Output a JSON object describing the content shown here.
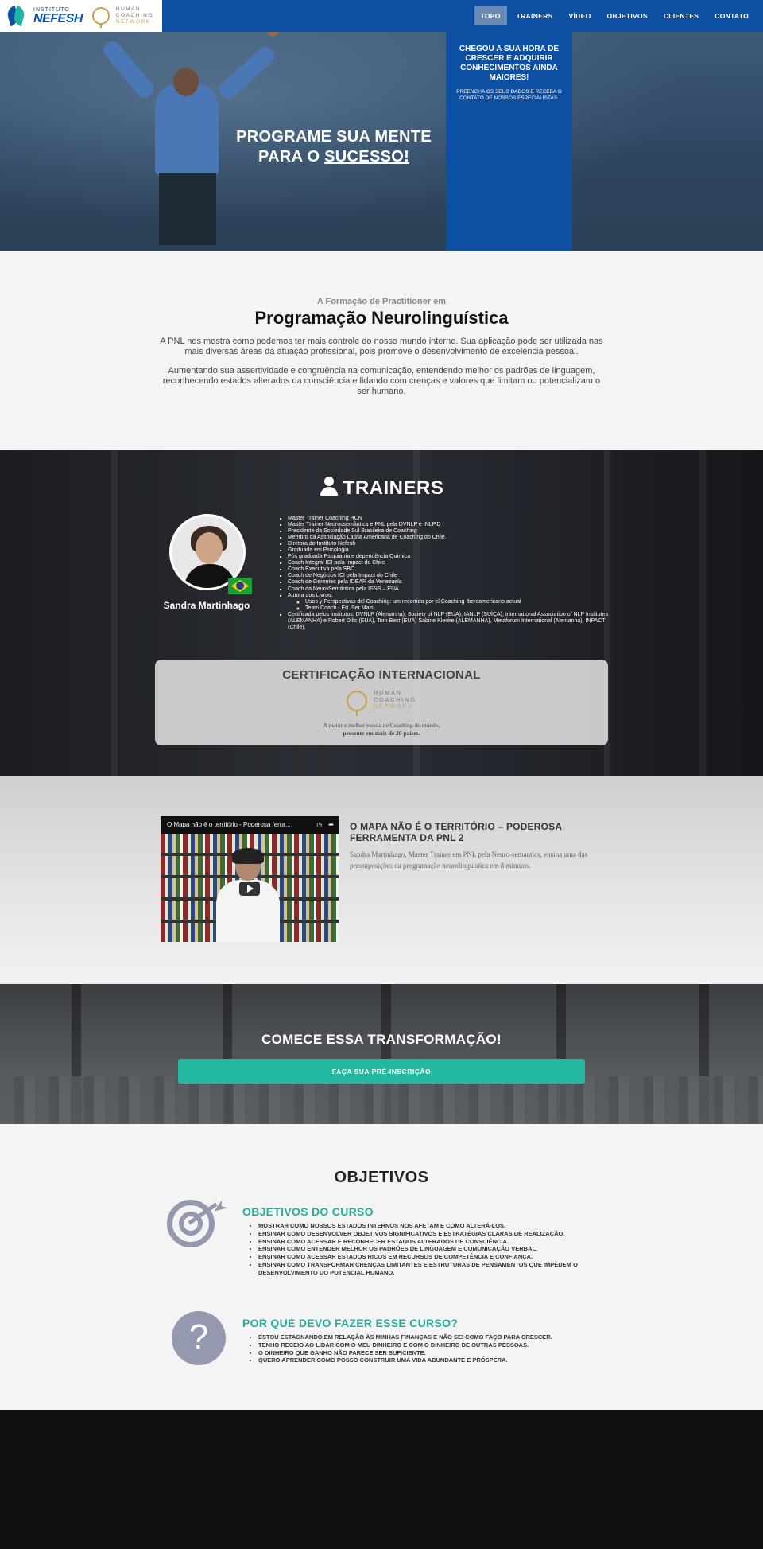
{
  "header": {
    "logo_small": "INSTITUTO",
    "logo_big": "NEFESH",
    "partner_logo": [
      "HUMAN",
      "COACHING",
      "NETWORK"
    ],
    "nav": [
      "TOPO",
      "TRAINERS",
      "VÍDEO",
      "OBJETIVOS",
      "CLIENTES",
      "CONTATO"
    ],
    "active_nav": "TOPO"
  },
  "hero": {
    "title_line1": "PROGRAME SUA MENTE",
    "title_line2_prefix": "PARA O ",
    "title_line2_link": "SUCESSO!",
    "box_title": "CHEGOU A SUA HORA DE CRESCER E ADQUIRIR CONHECIMENTOS AINDA MAIORES!",
    "box_text": "PREENCHA OS SEUS DADOS E RECEBA O CONTATO DE NOSSOS ESPECIALISTAS."
  },
  "intro": {
    "kicker": "A Formação de Practitioner em",
    "title": "Programação Neurolinguística",
    "p1": "A PNL nos mostra como podemos ter mais controle do nosso mundo interno. Sua aplicação pode ser utilizada nas mais diversas áreas da atuação profissional, pois promove o desenvolvimento de excelência pessoal.",
    "p2": "Aumentando sua assertividade e congruência na comunicação, entendendo melhor os padrões de linguagem, reconhecendo estados alterados da consciência e lidando com crenças e valores que limitam ou potencializam o ser humano."
  },
  "trainers": {
    "title": "TRAINERS",
    "name": "Sandra Martinhago",
    "credentials": [
      "Master Trainer Coaching HCN",
      "Master Trainer Neurossemântica e PNL pela DVNLP e INLP.D",
      "Presidente da Sociedade Sul Brasileira de Coaching",
      "Membro da Associação Latina Americana de Coaching do Chile.",
      "Diretora do Instituto Nefesh",
      "Graduada em Psicologia",
      "Pós graduada Psiquiatria e dependência Química",
      "Coach Integral ICI pela Impact do Chile",
      "Coach Executiva pela SBC",
      "Coach de Negócios ICI pela Impact do Chile",
      "Coach de Gerentes pela IDEAR da Venezuela",
      "Coach da NeuroSemântica pela ISNS – EUA",
      "Autora dos Livros:"
    ],
    "books": [
      "Usos y Perspectivas del Coaching: um recorrido por el Coaching Iberoamericano actual",
      "Team Coach - Ed. Ser Mais"
    ],
    "certified": "Certificada pelos institutos: DVNLP (Alemanha), Society of NLP (EUA), IANLP (SUÍÇA), International Association of NLP Institutes (ALEMANHA) e Robert Dilts (EUA), Tom Best (EUA) Sabine Klenke (ALEMANHA), Metaforum International (Alemanha), INPACT (Chile).",
    "cert_title": "CERTIFICAÇÃO INTERNACIONAL",
    "cert_logo": [
      "HUMAN",
      "COACHING",
      "NETWORK"
    ],
    "cert_line1": "A maior e melhor escola de Coaching do mundo,",
    "cert_line2": "presente em mais de 20 países."
  },
  "video": {
    "player_title": "O Mapa não é o território - Poderosa ferra...",
    "title": "O MAPA NÃO É O TERRITÓRIO – PODEROSA FERRAMENTA DA PNL 2",
    "description": "Sandra Martinhago, Master Trainer em PNL pela Neuro-semantics, ensina uma das pressuposições da programação neurolinguística em 8 minutos."
  },
  "cta": {
    "title": "COMECE ESSA TRANSFORMAÇÃO!",
    "button": "FAÇA SUA PRÉ-INSCRIÇÃO"
  },
  "objetivos": {
    "title": "OBJETIVOS",
    "course_title": "OBJETIVOS DO CURSO",
    "course_items": [
      "MOSTRAR COMO NOSSOS ESTADOS INTERNOS NOS AFETAM E COMO ALTERÁ-LOS.",
      "ENSINAR COMO DESENVOLVER OBJETIVOS SIGNIFICATIVOS E ESTRATÉGIAS CLARAS DE REALIZAÇÃO.",
      "ENSINAR COMO ACESSAR E RECONHECER ESTADOS ALTERADOS DE CONSCIÊNCIA.",
      "ENSINAR COMO ENTENDER MELHOR OS PADRÕES DE LINGUAGEM E COMUNICAÇÃO VERBAL.",
      "ENSINAR COMO ACESSAR ESTADOS RICOS EM RECURSOS DE COMPETÊNCIA E CONFIANÇA.",
      "ENSINAR COMO TRANSFORMAR CRENÇAS LIMITANTES E ESTRUTURAS DE PENSAMENTOS QUE IMPEDEM O DESENVOLVIMENTO DO POTENCIAL HUMANO."
    ],
    "why_title": "POR QUE DEVO FAZER ESSE CURSO?",
    "why_items": [
      "ESTOU ESTAGNANDO EM RELAÇÃO ÀS MINHAS FINANÇAS E NÃO SEI COMO FAÇO PARA CRESCER.",
      "TENHO RECEIO AO LIDAR COM O MEU DINHEIRO E COM O DINHEIRO DE OUTRAS PESSOAS.",
      "O DINHEIRO QUE GANHO NÃO PARECE SER SUFICIENTE.",
      "QUERO APRENDER COMO POSSO CONSTRUIR UMA VIDA ABUNDANTE E PRÓSPERA."
    ]
  },
  "colors": {
    "brand_blue": "#0d4fa3",
    "accent_green": "#23b8a0",
    "icon_gray": "#9499b0"
  }
}
